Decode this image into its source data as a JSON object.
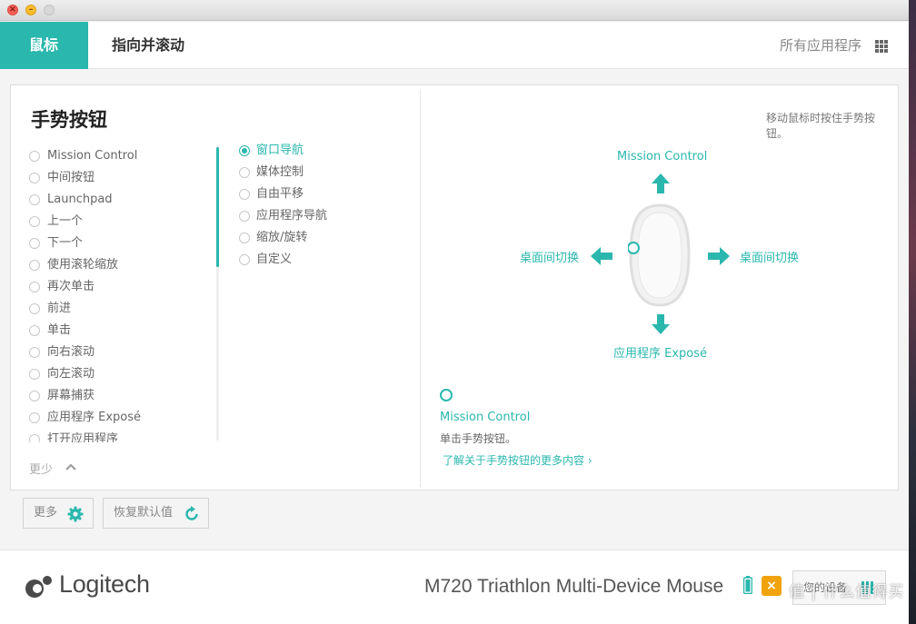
{
  "nav": {
    "tab_mouse": "鼠标",
    "tab_point_scroll": "指向并滚动",
    "all_apps": "所有应用程序"
  },
  "panel": {
    "title": "手势按钮",
    "list": [
      {
        "label": "Mission Control",
        "selected": false
      },
      {
        "label": "中间按钮",
        "selected": false
      },
      {
        "label": "Launchpad",
        "selected": false
      },
      {
        "label": "上一个",
        "selected": false
      },
      {
        "label": "下一个",
        "selected": false
      },
      {
        "label": "使用滚轮缩放",
        "selected": false
      },
      {
        "label": "再次单击",
        "selected": false
      },
      {
        "label": "前进",
        "selected": false
      },
      {
        "label": "单击",
        "selected": false
      },
      {
        "label": "向右滚动",
        "selected": false
      },
      {
        "label": "向左滚动",
        "selected": false
      },
      {
        "label": "屏幕捕获",
        "selected": false
      },
      {
        "label": "应用程序 Exposé",
        "selected": false
      },
      {
        "label": "打开应用程序",
        "selected": false
      }
    ],
    "sublist": [
      {
        "label": "窗口导航",
        "selected": true
      },
      {
        "label": "媒体控制",
        "selected": false
      },
      {
        "label": "自由平移",
        "selected": false
      },
      {
        "label": "应用程序导航",
        "selected": false
      },
      {
        "label": "缩放/旋转",
        "selected": false
      },
      {
        "label": "自定义",
        "selected": false
      }
    ],
    "less": "更少",
    "hint": "移动鼠标时按住手势按钮。",
    "gesture": {
      "up": "Mission Control",
      "left": "桌面间切换",
      "right": "桌面间切换",
      "down": "应用程序 Exposé"
    },
    "selected_title": "Mission Control",
    "selected_desc": "单击手势按钮。",
    "learn_more": "了解关于手势按钮的更多内容"
  },
  "buttons": {
    "more": "更多",
    "reset": "恢复默认值"
  },
  "footer": {
    "logo": "Logitech",
    "device": "M720 Triathlon Multi-Device Mouse",
    "your_devices": "您的设备"
  },
  "watermark": "值 | 什么值得买",
  "colors": {
    "accent": "#2ab7ad",
    "badge": "#f1a30d"
  }
}
